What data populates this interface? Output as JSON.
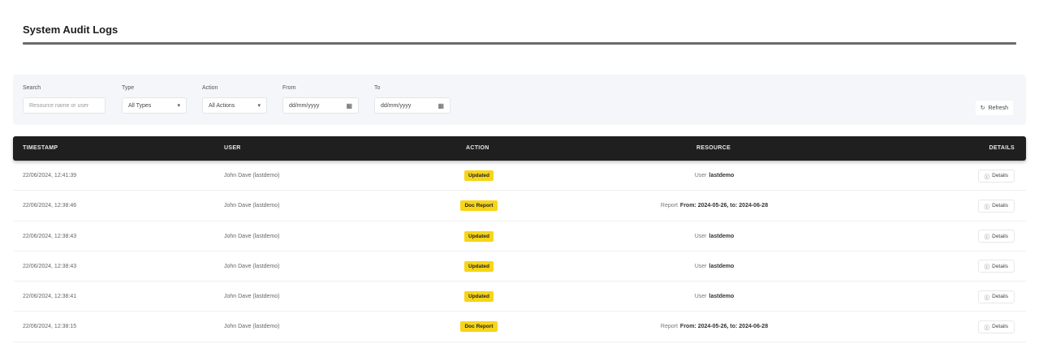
{
  "header": {
    "title": "System Audit Logs"
  },
  "filters": {
    "search_label": "Search",
    "search_placeholder": "Resource name or user",
    "type_label": "Type",
    "type_value": "All Types",
    "action_label": "Action",
    "action_value": "All Actions",
    "from_label": "From",
    "from_value": "dd/mm/yyyy",
    "to_label": "To",
    "to_value": "dd/mm/yyyy",
    "refresh_label": "Refresh"
  },
  "table": {
    "columns": [
      "TIMESTAMP",
      "USER",
      "ACTION",
      "RESOURCE",
      "DETAILS"
    ],
    "rows": [
      {
        "timestamp": "22/06/2024, 12:41:39",
        "user": "John Dave (lastdemo)",
        "action": "Updated",
        "resource_type": "User",
        "resource_name": "lastdemo",
        "details_label": "Details"
      },
      {
        "timestamp": "22/06/2024, 12:38:46",
        "user": "John Dave (lastdemo)",
        "action": "Doc Report",
        "resource_type": "Report",
        "resource_name": "From: 2024-05-26, to: 2024-06-28",
        "details_label": "Details"
      },
      {
        "timestamp": "22/06/2024, 12:38:43",
        "user": "John Dave (lastdemo)",
        "action": "Updated",
        "resource_type": "User",
        "resource_name": "lastdemo",
        "details_label": "Details"
      },
      {
        "timestamp": "22/06/2024, 12:38:43",
        "user": "John Dave (lastdemo)",
        "action": "Updated",
        "resource_type": "User",
        "resource_name": "lastdemo",
        "details_label": "Details"
      },
      {
        "timestamp": "22/06/2024, 12:38:41",
        "user": "John Dave (lastdemo)",
        "action": "Updated",
        "resource_type": "User",
        "resource_name": "lastdemo",
        "details_label": "Details"
      },
      {
        "timestamp": "22/06/2024, 12:38:15",
        "user": "John Dave (lastdemo)",
        "action": "Doc Report",
        "resource_type": "Report",
        "resource_name": "From: 2024-05-26, to: 2024-06-28",
        "details_label": "Details"
      }
    ]
  },
  "colors": {
    "accent_badge": "#f7d518",
    "table_header": "#1f1f1f",
    "filter_bg": "#f4f6f9"
  },
  "icons": {
    "select_caret": "chevron-down-icon",
    "date": "calendar-icon",
    "refresh": "refresh-icon",
    "details": "info-icon"
  }
}
